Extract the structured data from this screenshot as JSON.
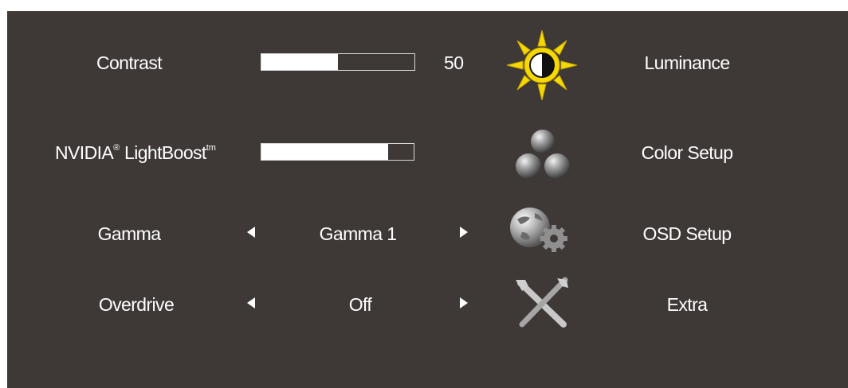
{
  "menu": {
    "settings": [
      {
        "label": "Contrast",
        "type": "slider",
        "value": 50,
        "value_text": "50"
      },
      {
        "label": "NVIDIA",
        "sup1": "®",
        "label_b": " LightBoost",
        "sup2": "tm",
        "type": "slider",
        "value": 83
      },
      {
        "label": "Gamma",
        "type": "selector",
        "value_text": "Gamma 1"
      },
      {
        "label": "Overdrive",
        "type": "selector",
        "value_text": "Off"
      }
    ],
    "categories": [
      {
        "label": "Luminance",
        "icon": "sun-contrast-icon",
        "selected": true
      },
      {
        "label": "Color Setup",
        "icon": "color-spheres-icon"
      },
      {
        "label": "OSD Setup",
        "icon": "globe-gear-icon"
      },
      {
        "label": "Extra",
        "icon": "tools-icon"
      }
    ]
  },
  "colors": {
    "panel_bg": "#3e3836",
    "text": "#ffffff",
    "sun_yellow": "#f5d800"
  }
}
